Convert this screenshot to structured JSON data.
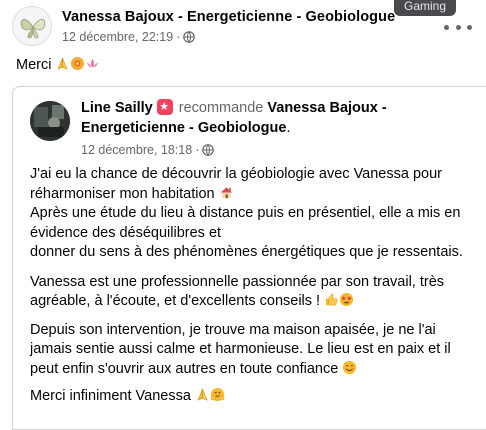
{
  "tooltip": {
    "text": "Gaming"
  },
  "post": {
    "page_name": "Vanessa Bajoux - Energeticienne - Geobiologue",
    "date": "12 décembre, 22:19",
    "dot": "·",
    "text": "Merci",
    "emojis": [
      "folded-hands",
      "sun-flower",
      "lotus"
    ]
  },
  "recommendation": {
    "author": "Line Sailly",
    "verb": "recommande",
    "page_part1": "Vanessa Bajoux -",
    "page_part2": "Energeticienne - Geobiologue",
    "period": ".",
    "date": "12 décembre, 18:18",
    "dot": "·",
    "review": {
      "p1_line1": "J'ai eu la chance de découvrir la géobiologie avec Vanessa pour",
      "p1_line2": "réharmoniser mon habitation",
      "p1_line3": "Après une étude du lieu à distance puis en présentiel, elle a mis en",
      "p1_line4": "évidence des déséquilibres et",
      "p1_line5": "donner du sens à des phénomènes énergétiques que je ressentais.",
      "p2_line1": "Vanessa est une professionnelle passionnée par son travail, très",
      "p2_line2": "agréable, à l'écoute, et d'excellents conseils !",
      "p3_line1": "Depuis son intervention, je trouve ma maison apaisée, je ne l'ai",
      "p3_line2": "jamais sentie aussi calme et harmonieuse. Le lieu est en paix et il",
      "p3_line3": "peut enfin s'ouvrir aux autres en toute confiance",
      "p4_line1": "Merci infiniment Vanessa"
    }
  },
  "colors": {
    "text": "#050505",
    "secondary": "#65676b",
    "border": "#ced0d4",
    "recommend_badge": "#f3425f"
  }
}
